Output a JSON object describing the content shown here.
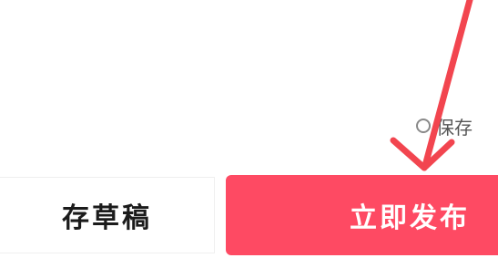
{
  "save_local": {
    "label": "保存"
  },
  "actions": {
    "draft_label": "存草稿",
    "publish_label": "立即发布"
  },
  "colors": {
    "accent": "#fe4a63",
    "arrow": "#f2454f"
  },
  "icons": {
    "radio": "radio-circle-icon",
    "annotation": "red-arrow-annotation"
  }
}
